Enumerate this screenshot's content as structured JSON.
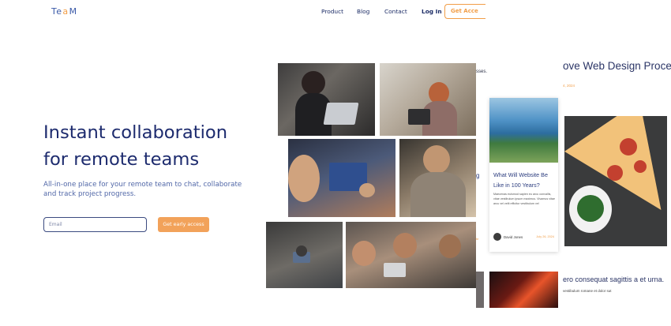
{
  "brand": {
    "logo_part1": "Te",
    "logo_accent": "a",
    "logo_part2": "M"
  },
  "nav": {
    "product": "Product",
    "blog": "Blog",
    "contact": "Contact",
    "login": "Log In",
    "cta": "Get Acce"
  },
  "hero": {
    "headline_line1": "Instant collaboration",
    "headline_line2": "for remote teams",
    "subtitle": "All-in-one place for your remote team to chat, collaborate and track project progress.",
    "email_placeholder": "Email",
    "cta": "Get early access"
  },
  "blog": {
    "partial_text_top": "sses.",
    "partial_text_mid": "g",
    "partial_text_low": "te",
    "card": {
      "title": "What Will Website Be Like in 100 Years?",
      "excerpt": "Maecenas euismod sapien eu arcu convallis, vitae vestibulum ipsum maximus. Vivamus vitae arcu vel velit efficitur vestibulum vel",
      "author": "David Jones",
      "date": "July 26, 2024"
    },
    "post": {
      "title": "ove Web Design Process",
      "date": "4, 2024",
      "bottom_title": "ero consequat sagittis a et urna.",
      "bottom_excerpt": "vestibulum romane et dolor sut"
    }
  },
  "colors": {
    "accent": "#f19e48",
    "navy": "#1d2b6e",
    "link_blue": "#5268a8"
  }
}
